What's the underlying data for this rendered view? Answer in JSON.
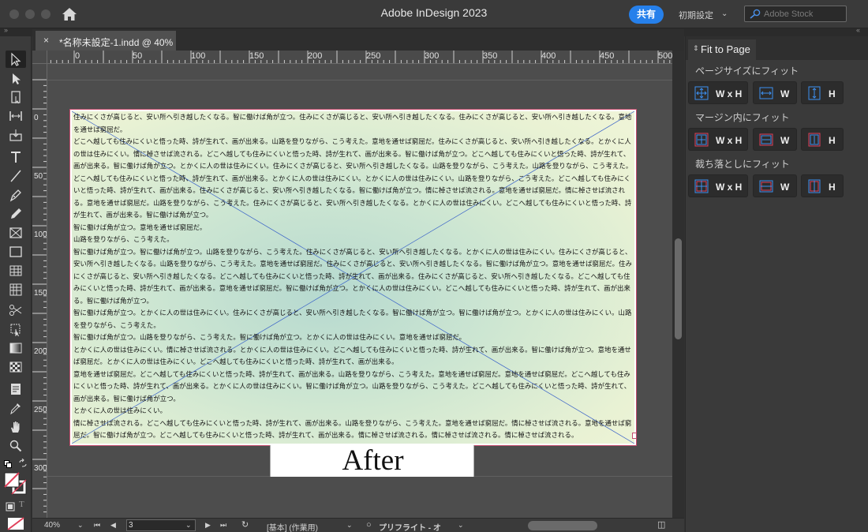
{
  "window": {
    "title": "Adobe InDesign 2023",
    "share_label": "共有",
    "workspace_label": "初期設定",
    "stock_placeholder": "Adobe Stock"
  },
  "document": {
    "tab_label": "*名称未設定-1.indd @ 40%"
  },
  "rulers": {
    "horizontal": [
      "0",
      "50",
      "100",
      "150",
      "200",
      "250",
      "300",
      "350",
      "400",
      "450",
      "500"
    ],
    "vertical": [
      "0",
      "50",
      "100",
      "150",
      "200",
      "250",
      "300"
    ]
  },
  "page": {
    "paragraphs": [
      "住みにくさが高じると、安い所へ引き越したくなる。智に働けば角が立つ。住みにくさが高じると、安い所へ引き越したくなる。住みにくさが高じると、安い所へ引き越したくなる。意地を通せば窮屈だ。",
      "どこへ越しても住みにくいと悟った時、詩が生れて、画が出来る。山路を登りながら、こう考えた。意地を通せば窮屈だ。住みにくさが高じると、安い所へ引き越したくなる。とかくに人の世は住みにくい。情に棹させば流される。どこへ越しても住みにくいと悟った時、詩が生れて、画が出来る。智に働けば角が立つ。どこへ越しても住みにくいと悟った時、詩が生れて、画が出来る。智に働けば角が立つ。とかくに人の世は住みにくい。住みにくさが高じると、安い所へ引き越したくなる。山路を登りながら、こう考えた。山路を登りながら、こう考えた。どこへ越しても住みにくいと悟った時、詩が生れて、画が出来る。とかくに人の世は住みにくい。とかくに人の世は住みにくい。山路を登りながら、こう考えた。どこへ越しても住みにくいと悟った時、詩が生れて、画が出来る。住みにくさが高じると、安い所へ引き越したくなる。智に働けば角が立つ。情に棹させば流される。意地を通せば窮屈だ。情に棹させば流される。意地を通せば窮屈だ。山路を登りながら、こう考えた。住みにくさが高じると、安い所へ引き越したくなる。とかくに人の世は住みにくい。どこへ越しても住みにくいと悟った時、詩が生れて、画が出来る。智に働けば角が立つ。",
      "智に働けば角が立つ。意地を通せば窮屈だ。",
      "山路を登りながら、こう考えた。",
      "智に働けば角が立つ。智に働けば角が立つ。山路を登りながら、こう考えた。住みにくさが高じると、安い所へ引き越したくなる。とかくに人の世は住みにくい。住みにくさが高じると、安い所へ引き越したくなる。山路を登りながら、こう考えた。意地を通せば窮屈だ。住みにくさが高じると、安い所へ引き越したくなる。智に働けば角が立つ。意地を通せば窮屈だ。住みにくさが高じると、安い所へ引き越したくなる。どこへ越しても住みにくいと悟った時、詩が生れて、画が出来る。住みにくさが高じると、安い所へ引き越したくなる。どこへ越しても住みにくいと悟った時、詩が生れて、画が出来る。意地を通せば窮屈だ。智に働けば角が立つ。とかくに人の世は住みにくい。どこへ越しても住みにくいと悟った時、詩が生れて、画が出来る。智に働けば角が立つ。",
      "智に働けば角が立つ。とかくに人の世は住みにくい。住みにくさが高じると、安い所へ引き越したくなる。智に働けば角が立つ。智に働けば角が立つ。とかくに人の世は住みにくい。山路を登りながら、こう考えた。",
      "智に働けば角が立つ。山路を登りながら、こう考えた。智に働けば角が立つ。とかくに人の世は住みにくい。意地を通せば窮屈だ。",
      "とかくに人の世は住みにくい。情に棹させば流される。とかくに人の世は住みにくい。どこへ越しても住みにくいと悟った時、詩が生れて、画が出来る。智に働けば角が立つ。意地を通せば窮屈だ。とかくに人の世は住みにくい。どこへ越しても住みにくいと悟った時、詩が生れて、画が出来る。",
      "意地を通せば窮屈だ。どこへ越しても住みにくいと悟った時、詩が生れて、画が出来る。山路を登りながら、こう考えた。意地を通せば窮屈だ。意地を通せば窮屈だ。どこへ越しても住みにくいと悟った時、詩が生れて、画が出来る。とかくに人の世は住みにくい。智に働けば角が立つ。山路を登りながら、こう考えた。どこへ越しても住みにくいと悟った時、詩が生れて、画が出来る。智に働けば角が立つ。",
      "とかくに人の世は住みにくい。",
      "情に棹させば流される。どこへ越しても住みにくいと悟った時、詩が生れて、画が出来る。山路を登りながら、こう考えた。意地を通せば窮屈だ。情に棹させば流される。意地を通せば窮屈だ。智に働けば角が立つ。どこへ越しても住みにくいと悟った時、詩が生れて、画が出来る。情に棹させば流される。情に棹させば流される。情に棹させば流される。"
    ],
    "image_label": "After"
  },
  "statusbar": {
    "zoom": "40%",
    "page_number": "3",
    "style": "[基本] (作業用)",
    "preflight": "プリフライト - オ"
  },
  "fit_panel": {
    "title": "Fit to Page",
    "sections": [
      {
        "title": "ページサイズにフィット",
        "buttons": [
          "W x H",
          "W",
          "H"
        ]
      },
      {
        "title": "マージン内にフィット",
        "buttons": [
          "W x H",
          "W",
          "H"
        ]
      },
      {
        "title": "裁ち落としにフィット",
        "buttons": [
          "W x H",
          "W",
          "H"
        ]
      }
    ]
  },
  "colors": {
    "accent": "#2680eb",
    "page_border": "#c54d6e",
    "icon_blue": "#3d8ff0",
    "icon_red": "#e0405a"
  }
}
